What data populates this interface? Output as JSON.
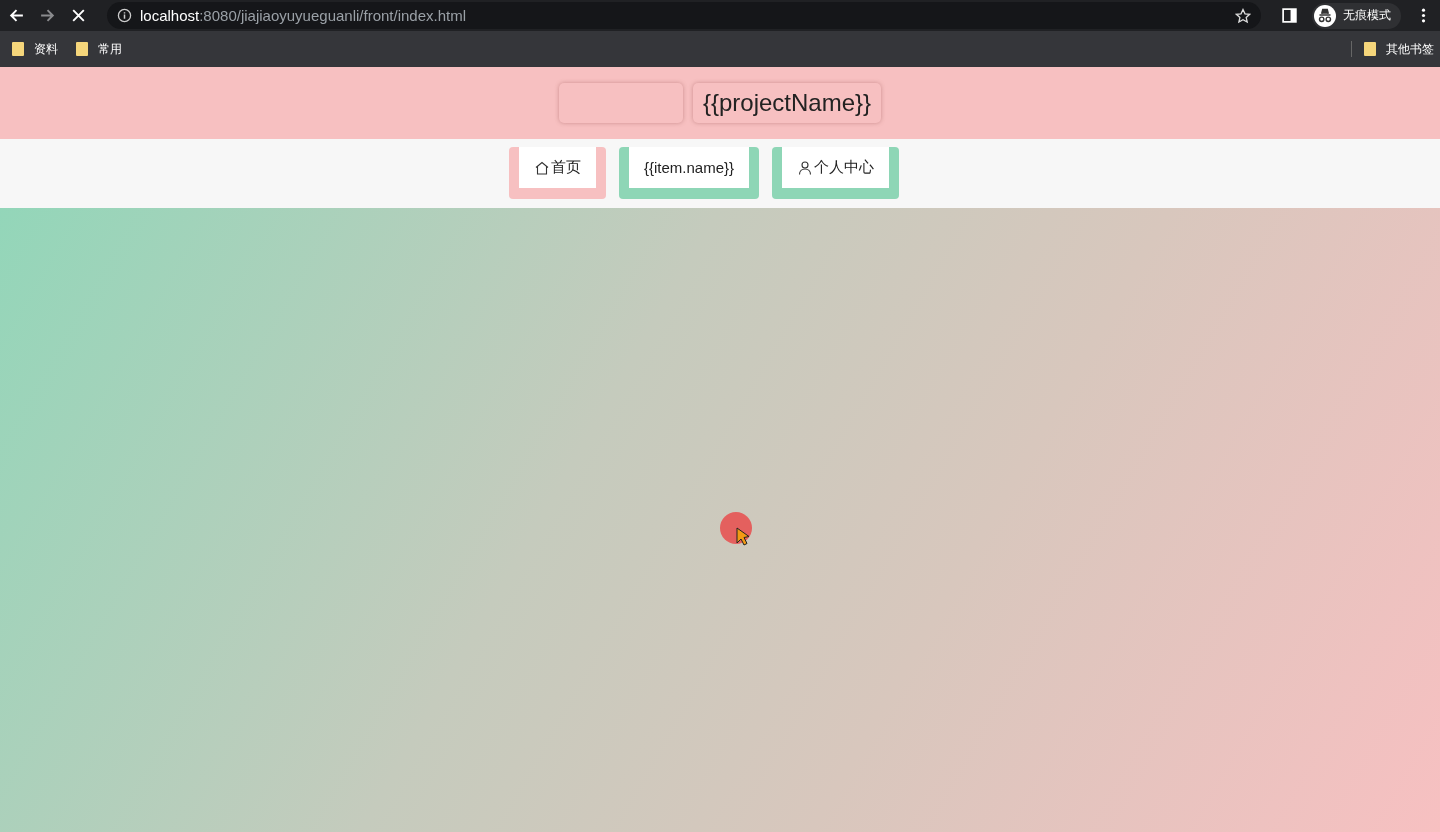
{
  "browser": {
    "url_host": "localhost",
    "url_path": ":8080/jiajiaoyuyueguanli/front/index.html",
    "profile_label": "无痕模式",
    "bookmarks": [
      {
        "label": "资料"
      },
      {
        "label": "常用"
      }
    ],
    "other_bookmarks": "其他书签"
  },
  "header": {
    "title": "{{projectName}}"
  },
  "nav": [
    {
      "label": "首页",
      "kind": "home",
      "selected": true
    },
    {
      "label": "{{item.name}}",
      "kind": "plain",
      "selected": false
    },
    {
      "label": "个人中心",
      "kind": "user",
      "selected": false
    }
  ]
}
